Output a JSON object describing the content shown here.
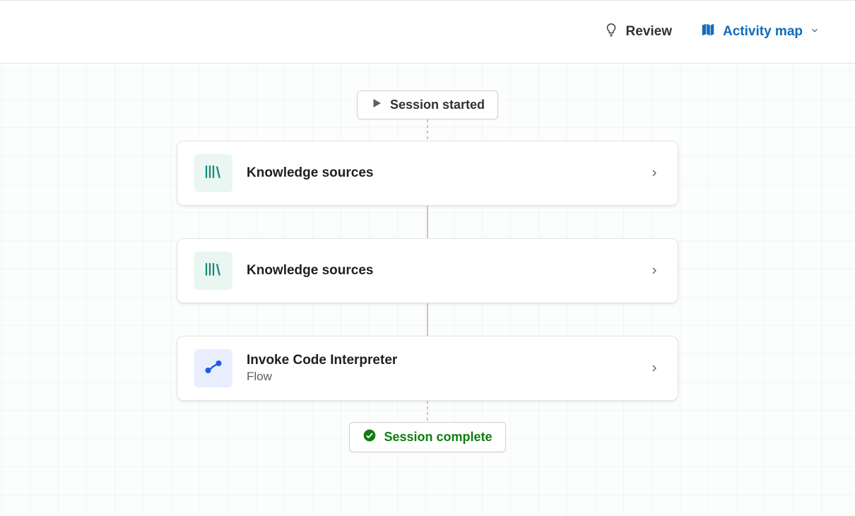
{
  "header": {
    "review_label": "Review",
    "activity_map_label": "Activity map"
  },
  "session": {
    "started_label": "Session started",
    "complete_label": "Session complete"
  },
  "nodes": [
    {
      "title": "Knowledge sources",
      "subtitle": null,
      "icon": "library-icon",
      "icon_bg": "knowledge"
    },
    {
      "title": "Knowledge sources",
      "subtitle": null,
      "icon": "library-icon",
      "icon_bg": "knowledge"
    },
    {
      "title": "Invoke Code Interpreter",
      "subtitle": "Flow",
      "icon": "flow-icon",
      "icon_bg": "flow"
    }
  ],
  "colors": {
    "accent": "#0f6cbd",
    "success": "#107c10",
    "teal": "#0f8a7a",
    "blue": "#1a5fe0"
  }
}
